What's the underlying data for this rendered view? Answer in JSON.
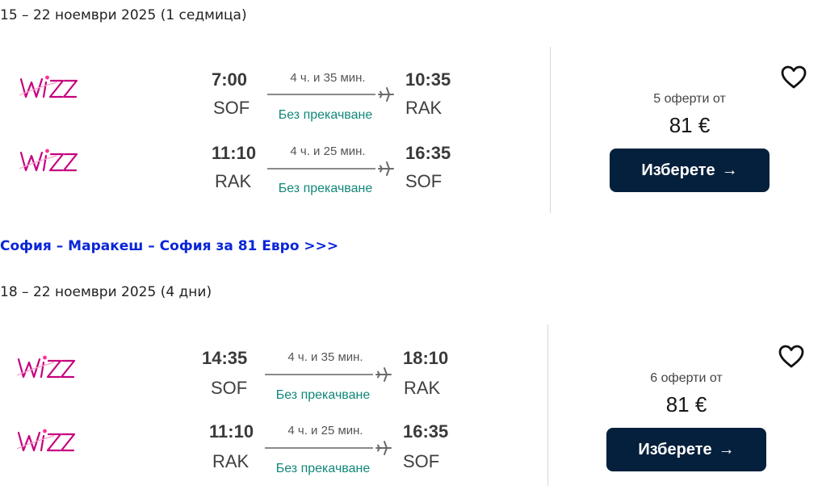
{
  "sections": [
    {
      "date_heading": "15 – 22 ноември 2025 (1 седмица)",
      "card": {
        "legs": [
          {
            "airline": "Wizz Air",
            "dep_time": "7:00",
            "dep_code": "SOF",
            "duration": "4 ч. и 35 мин.",
            "stops": "Без прекачване",
            "arr_time": "10:35",
            "arr_code": "RAK"
          },
          {
            "airline": "Wizz Air",
            "dep_time": "11:10",
            "dep_code": "RAK",
            "duration": "4 ч. и 25 мин.",
            "stops": "Без прекачване",
            "arr_time": "16:35",
            "arr_code": "SOF"
          }
        ],
        "offers": "5 оферти от",
        "price": "81 €",
        "select_label": "Изберете",
        "select_arrow": "→"
      },
      "deal_link": "София – Маракеш – София за 81 Евро >>>"
    },
    {
      "date_heading": "18 – 22 ноември 2025 (4 дни)",
      "card": {
        "legs": [
          {
            "airline": "Wizz Air",
            "dep_time": "14:35",
            "dep_code": "SOF",
            "duration": "4 ч. и 35 мин.",
            "stops": "Без прекачване",
            "arr_time": "18:10",
            "arr_code": "RAK"
          },
          {
            "airline": "Wizz Air",
            "dep_time": "11:10",
            "dep_code": "RAK",
            "duration": "4 ч. и 25 мин.",
            "stops": "Без прекачване",
            "arr_time": "16:35",
            "arr_code": "SOF"
          }
        ],
        "offers": "6 оферти от",
        "price": "81 €",
        "select_label": "Изберете",
        "select_arrow": "→"
      }
    }
  ],
  "icons": {
    "airline_logo": "wizz-air-logo",
    "plane": "plane-icon",
    "heart": "heart-icon"
  },
  "colors": {
    "button_bg": "#05203c",
    "stops_text": "#11877a",
    "link": "#0a26d8",
    "logo": "#c6007e"
  }
}
